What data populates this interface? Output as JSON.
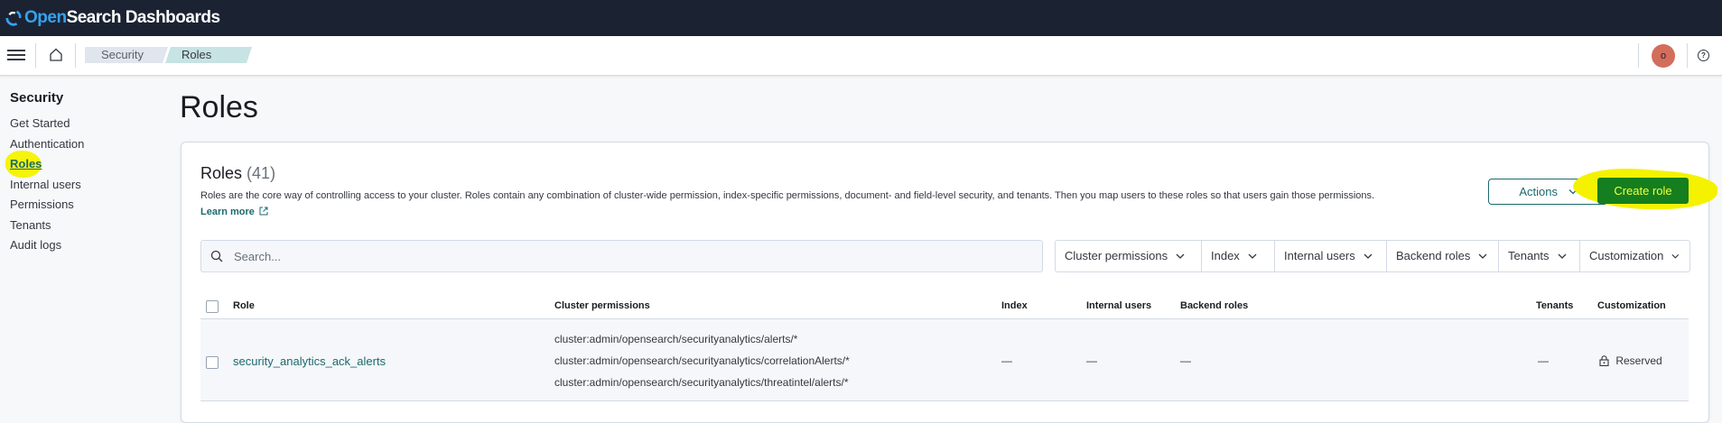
{
  "header": {
    "logo_open": "Open",
    "logo_rest": "Search Dashboards"
  },
  "breadcrumbs": [
    "Security",
    "Roles"
  ],
  "user": {
    "avatar_initial": "o"
  },
  "sidebar": {
    "title": "Security",
    "items": [
      {
        "label": "Get Started"
      },
      {
        "label": "Authentication"
      },
      {
        "label": "Roles",
        "active": true
      },
      {
        "label": "Internal users"
      },
      {
        "label": "Permissions"
      },
      {
        "label": "Tenants"
      },
      {
        "label": "Audit logs"
      }
    ]
  },
  "page": {
    "title": "Roles"
  },
  "panel": {
    "title": "Roles",
    "count": "(41)",
    "description": "Roles are the core way of controlling access to your cluster. Roles contain any combination of cluster-wide permission, index-specific permissions, document- and field-level security, and tenants. Then you map users to these roles so that users gain those permissions.",
    "learn_more": "Learn more",
    "actions_label": "Actions",
    "create_label": "Create role"
  },
  "search": {
    "placeholder": "Search..."
  },
  "filters": [
    "Cluster permissions",
    "Index",
    "Internal users",
    "Backend roles",
    "Tenants",
    "Customization"
  ],
  "table": {
    "columns": [
      "Role",
      "Cluster permissions",
      "Index",
      "Internal users",
      "Backend roles",
      "Tenants",
      "Customization"
    ],
    "rows": [
      {
        "role": "security_analytics_ack_alerts",
        "cluster_permissions": [
          "cluster:admin/opensearch/securityanalytics/alerts/*",
          "cluster:admin/opensearch/securityanalytics/correlationAlerts/*",
          "cluster:admin/opensearch/securityanalytics/threatintel/alerts/*"
        ],
        "index": "—",
        "internal_users": "—",
        "backend_roles": "—",
        "tenants": "—",
        "customization": "Reserved"
      }
    ]
  },
  "colors": {
    "header_bg": "#1b2333",
    "accent": "#1b6a6e",
    "create_btn": "#157e1e",
    "highlight": "#f5f200"
  }
}
